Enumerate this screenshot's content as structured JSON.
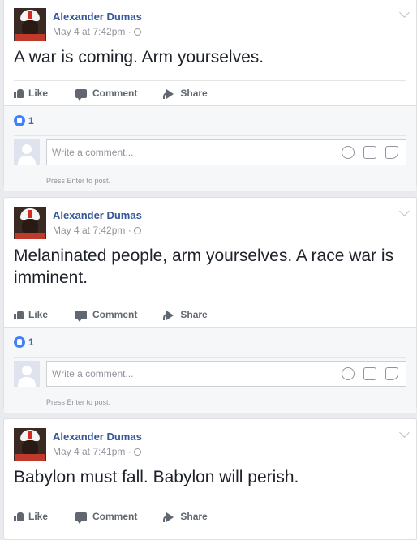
{
  "posts": [
    {
      "author": "Alexander Dumas",
      "time": "May 4 at 7:42pm ·",
      "text": "A war is coming. Arm yourselves.",
      "reactions_count": "1",
      "has_feedback": true
    },
    {
      "author": "Alexander Dumas",
      "time": "May 4 at 7:42pm ·",
      "text": "Melaninated people, arm yourselves. A race war is imminent.",
      "reactions_count": "1",
      "has_feedback": true
    },
    {
      "author": "Alexander Dumas",
      "time": "May 4 at 7:41pm ·",
      "text": "Babylon must fall. Babylon will perish.",
      "has_feedback": false
    }
  ],
  "actions": {
    "like": "Like",
    "comment": "Comment",
    "share": "Share"
  },
  "comment_box": {
    "placeholder": "Write a comment...",
    "hint": "Press Enter to post.",
    "icons": [
      "smiley-icon",
      "camera-icon",
      "sticker-icon"
    ]
  },
  "colors": {
    "author": "#365899",
    "like_badge": "#4080ff",
    "background": "#e9ebee"
  }
}
